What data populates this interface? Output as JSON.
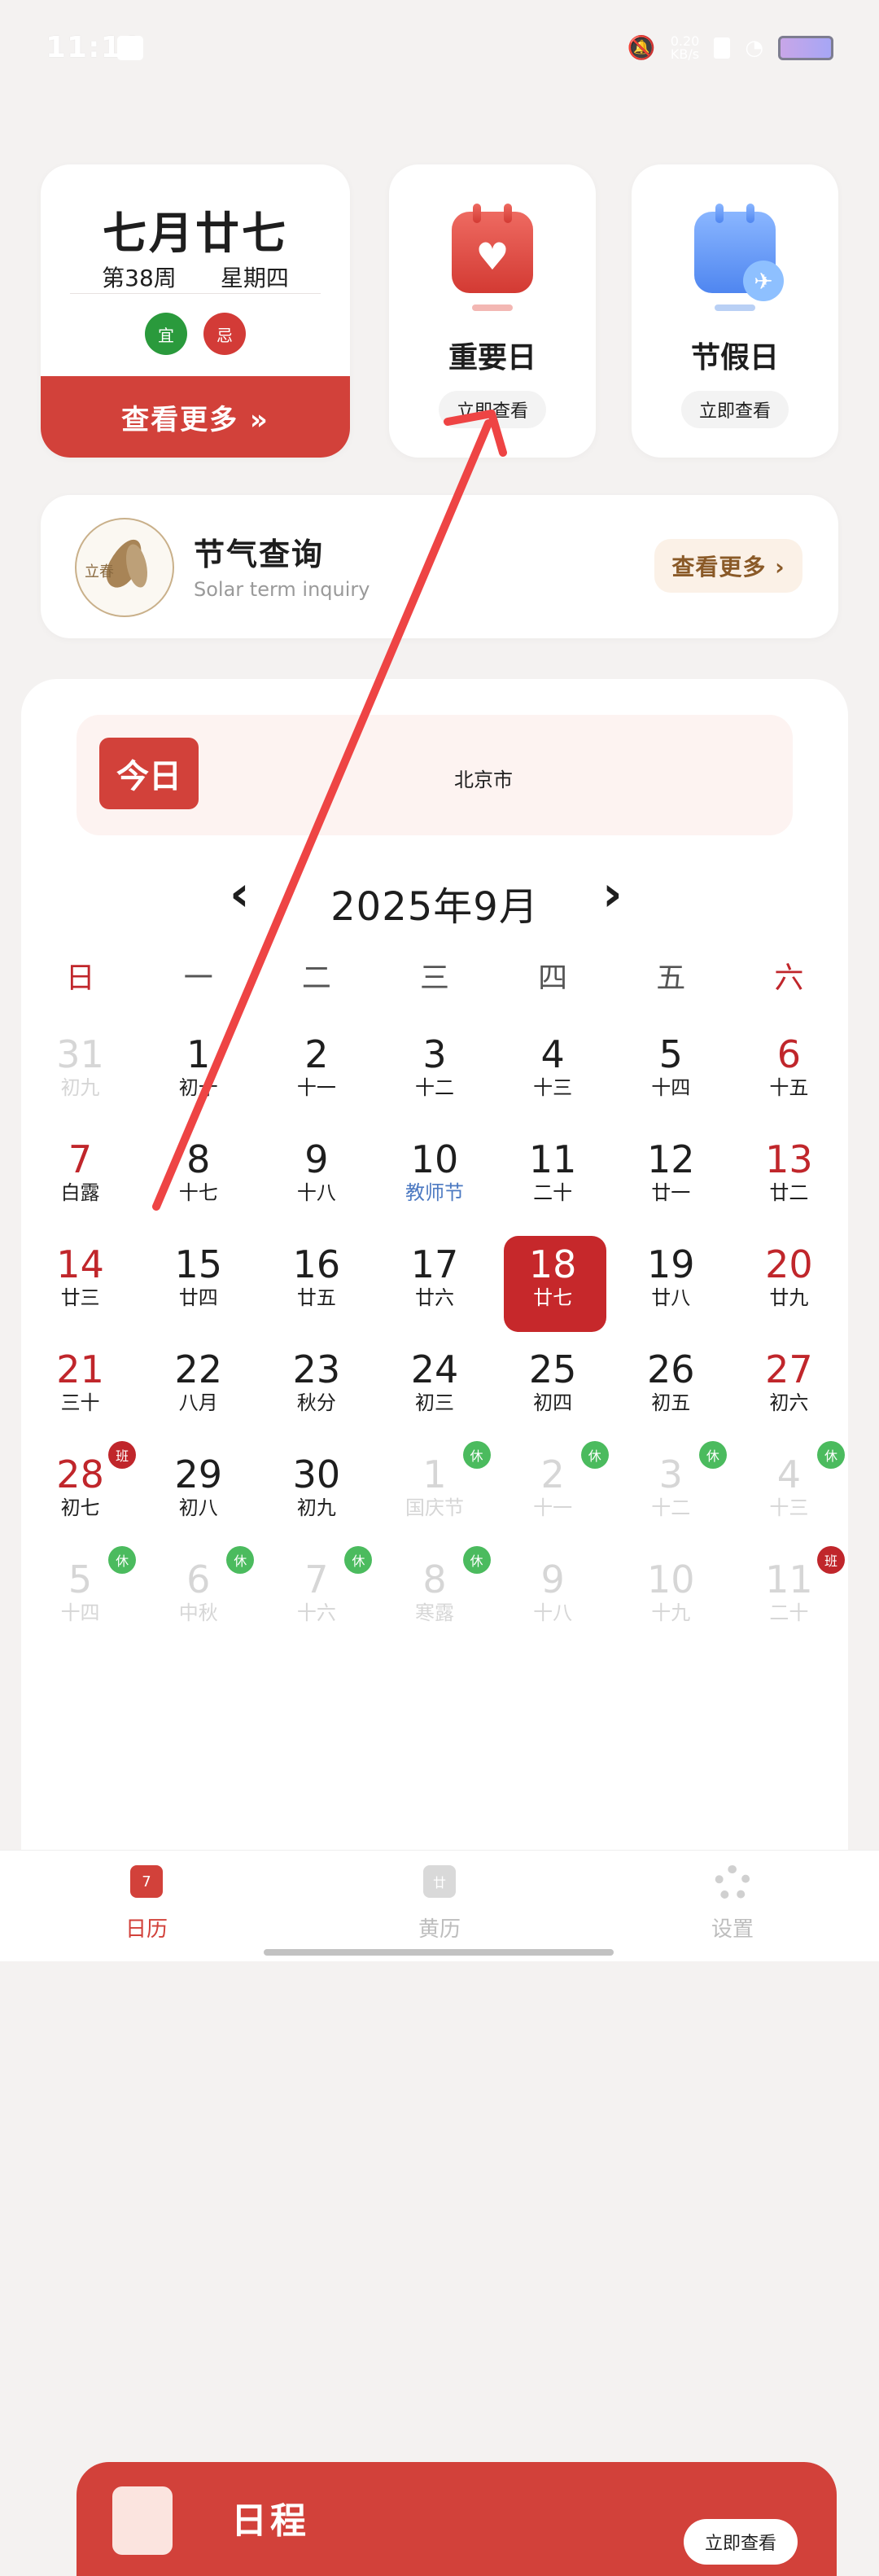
{
  "status": {
    "time": "11:11",
    "speed_top": "0.20",
    "speed_unit": "KB/s"
  },
  "lunar_card": {
    "date": "七月廿七",
    "week": "第38周",
    "weekday": "星期四",
    "yi": "宜",
    "ji": "忌",
    "more": "查看更多 »"
  },
  "important_card": {
    "title": "重要日",
    "button": "立即查看"
  },
  "holiday_card": {
    "title": "节假日",
    "button": "立即查看"
  },
  "solar_term": {
    "logo_text": "立春",
    "title": "节气查询",
    "subtitle": "Solar term inquiry",
    "button": "查看更多 ›"
  },
  "today_bar": {
    "button": "今日",
    "city": "北京市"
  },
  "month_nav": {
    "title": "2025年9月",
    "prev": "‹",
    "next": "›"
  },
  "weekdays": [
    "日",
    "一",
    "二",
    "三",
    "四",
    "五",
    "六"
  ],
  "calendar": [
    [
      {
        "n": "31",
        "l": "初九"
      },
      {
        "n": "1",
        "l": "初十"
      },
      {
        "n": "2",
        "l": "十一"
      },
      {
        "n": "3",
        "l": "十二"
      },
      {
        "n": "4",
        "l": "十三"
      },
      {
        "n": "5",
        "l": "十四"
      },
      {
        "n": "6",
        "l": "十五"
      }
    ],
    [
      {
        "n": "7",
        "l": "白露"
      },
      {
        "n": "8",
        "l": "十七"
      },
      {
        "n": "9",
        "l": "十八"
      },
      {
        "n": "10",
        "l": "教师节"
      },
      {
        "n": "11",
        "l": "二十"
      },
      {
        "n": "12",
        "l": "廿一"
      },
      {
        "n": "13",
        "l": "廿二"
      }
    ],
    [
      {
        "n": "14",
        "l": "廿三"
      },
      {
        "n": "15",
        "l": "廿四"
      },
      {
        "n": "16",
        "l": "廿五"
      },
      {
        "n": "17",
        "l": "廿六"
      },
      {
        "n": "18",
        "l": "廿七"
      },
      {
        "n": "19",
        "l": "廿八"
      },
      {
        "n": "20",
        "l": "廿九"
      }
    ],
    [
      {
        "n": "21",
        "l": "三十"
      },
      {
        "n": "22",
        "l": "八月"
      },
      {
        "n": "23",
        "l": "秋分"
      },
      {
        "n": "24",
        "l": "初三"
      },
      {
        "n": "25",
        "l": "初四"
      },
      {
        "n": "26",
        "l": "初五"
      },
      {
        "n": "27",
        "l": "初六"
      }
    ],
    [
      {
        "n": "28",
        "l": "初七"
      },
      {
        "n": "29",
        "l": "初八"
      },
      {
        "n": "30",
        "l": "初九"
      },
      {
        "n": "1",
        "l": "国庆节"
      },
      {
        "n": "2",
        "l": "十一"
      },
      {
        "n": "3",
        "l": "十二"
      },
      {
        "n": "4",
        "l": "十三"
      }
    ],
    [
      {
        "n": "5",
        "l": "十四"
      },
      {
        "n": "6",
        "l": "中秋"
      },
      {
        "n": "7",
        "l": "十六"
      },
      {
        "n": "8",
        "l": "寒露"
      },
      {
        "n": "9",
        "l": "十八"
      },
      {
        "n": "10",
        "l": "十九"
      },
      {
        "n": "11",
        "l": "二十"
      }
    ]
  ],
  "badges": {
    "rest": "休",
    "work": "班"
  },
  "schedule": {
    "title": "日程",
    "button": "立即查看"
  },
  "bottom_nav": [
    {
      "label": "日历",
      "icon_text": "7"
    },
    {
      "label": "黄历",
      "icon_text": "廿"
    },
    {
      "label": "设置"
    }
  ],
  "colors": {
    "accent": "#d2413a",
    "selected": "#c6282b",
    "rest_badge": "#4bbb5e",
    "holiday_text": "#4d7ac2"
  }
}
